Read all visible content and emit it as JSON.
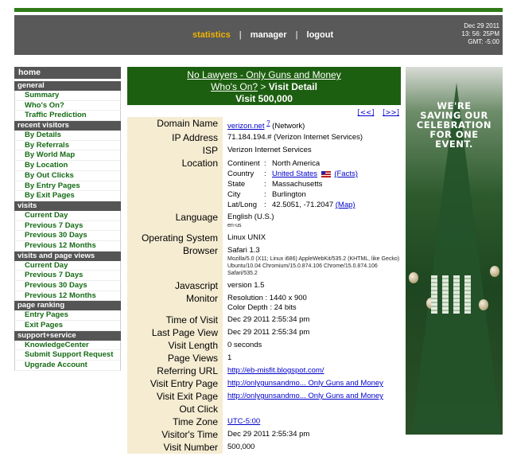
{
  "header": {
    "nav": [
      "statistics",
      "manager",
      "logout"
    ],
    "separator": "|",
    "datetime": [
      "Dec 29 2011",
      "13: 56: 25PM",
      "GMT: -5:00"
    ]
  },
  "sidebar": {
    "home": "home",
    "sections": [
      {
        "title": "general",
        "items": [
          "Summary",
          "Who's On?",
          "Traffic Prediction"
        ]
      },
      {
        "title": "recent visitors",
        "items": [
          "By Details",
          "By Referrals",
          "By World Map",
          "By Location",
          "By Out Clicks",
          "By Entry Pages",
          "By Exit Pages"
        ]
      },
      {
        "title": "visits",
        "items": [
          "Current Day",
          "Previous 7 Days",
          "Previous 30 Days",
          "Previous 12 Months"
        ]
      },
      {
        "title": "visits and page views",
        "items": [
          "Current Day",
          "Previous 7 Days",
          "Previous 30 Days",
          "Previous 12 Months"
        ]
      },
      {
        "title": "page ranking",
        "items": [
          "Entry Pages",
          "Exit Pages"
        ]
      },
      {
        "title": "support+service",
        "items": [
          "KnowledgeCenter",
          "Submit Support Request",
          "Upgrade Account"
        ]
      }
    ]
  },
  "main": {
    "site_title": "No Lawyers - Only Guns and Money",
    "breadcrumb_link": "Who's On?",
    "breadcrumb_sep": ">",
    "breadcrumb_current": "Visit Detail",
    "visit_title": "Visit 500,000",
    "pager_prev": "[<<]",
    "pager_next": "[>>]"
  },
  "detail": {
    "domain_label": "Domain Name",
    "domain_link": "verizon.net",
    "domain_q": "?",
    "domain_note": "(Network)",
    "ip_label": "IP Address",
    "ip_value": "71.184.194.# (Verizon Internet Services)",
    "isp_label": "ISP",
    "isp_value": "Verizon Internet Services",
    "location_label": "Location",
    "location": {
      "continent_k": "Continent",
      "continent_v": "North America",
      "country_k": "Country",
      "country_link": "United States",
      "country_facts": "(Facts)",
      "state_k": "State",
      "state_v": "Massachusetts",
      "city_k": "City",
      "city_v": "Burlington",
      "latlong_k": "Lat/Long",
      "latlong_v": "42.5051, -71.2047",
      "map_link": "(Map)",
      "colon": ":"
    },
    "language_label": "Language",
    "language_value": "English (U.S.)",
    "language_code": "en-us",
    "os_label": "Operating System",
    "os_value": "Linux UNIX",
    "browser_label": "Browser",
    "browser_value": "Safari 1.3",
    "browser_ua": "Mozilla/5.0 (X11; Linux i686) AppleWebKit/535.2 (KHTML, like Gecko) Ubuntu/10.04 Chromium/15.0.874.106 Chrome/15.0.874.106 Safari/535.2",
    "js_label": "Javascript",
    "js_value": "version 1.5",
    "monitor_label": "Monitor",
    "monitor_res": "Resolution  : 1440 x 900",
    "monitor_depth": "Color Depth : 24 bits",
    "tov_label": "Time of Visit",
    "tov_value": "Dec 29 2011 2:55:34 pm",
    "lpv_label": "Last Page View",
    "lpv_value": "Dec 29 2011 2:55:34 pm",
    "vl_label": "Visit Length",
    "vl_value": "0 seconds",
    "pv_label": "Page Views",
    "pv_value": "1",
    "ref_label": "Referring URL",
    "ref_value": "http://eb-misfit.blogspot.com/",
    "entry_label": "Visit Entry Page",
    "entry_value": "http://onlygunsandmo... Only Guns and Money",
    "exit_label": "Visit Exit Page",
    "exit_value": "http://onlygunsandmo... Only Guns and Money",
    "out_label": "Out Click",
    "tz_label": "Time Zone",
    "tz_value": "UTC-5:00",
    "vt_label": "Visitor's Time",
    "vt_value": "Dec 29 2011 2:55:34 pm",
    "vn_label": "Visit Number",
    "vn_value": "500,000"
  },
  "ad": {
    "text_lines": [
      "WE'RE",
      "SAVING OUR",
      "CELEBRATION",
      "FOR ONE",
      "EVENT."
    ]
  }
}
